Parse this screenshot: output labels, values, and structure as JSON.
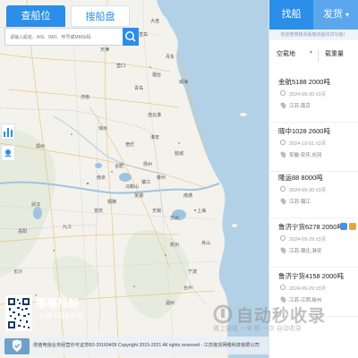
{
  "search": {
    "tabs": [
      {
        "label": "查船位"
      },
      {
        "label": "搜船盘"
      }
    ],
    "placeholder": "请输入船名、AIS、IMO、呼号或MMSI码"
  },
  "map_labels": [
    "南昌",
    "盘锦",
    "大连",
    "北京",
    "天津",
    "秦皇岛",
    "营口",
    "丹东",
    "青岛",
    "烟台",
    "威海",
    "济南",
    "徐州",
    "连云港",
    "南京",
    "上海",
    "合肥",
    "杭州",
    "宁波",
    "武汉",
    "岳阳",
    "长沙",
    "九江",
    "温州",
    "台州",
    "舟山",
    "苏州",
    "无锡",
    "南通",
    "扬州",
    "郑州",
    "芜湖",
    "安庆",
    "铜陵",
    "马鞍山",
    "镇江",
    "泰州",
    "盐城",
    "淮安",
    "宿迁"
  ],
  "promo": {
    "title": "嘟嘟找船",
    "subtitle": "扫描下载手机版"
  },
  "footer": {
    "text": "增值电信业务经营许可证苏B2-20160409    Copyright 2015-2021  All rights reserved  -  江苏拖货网络科技有限公司"
  },
  "panel": {
    "tabs": [
      {
        "label": "找船"
      },
      {
        "label": "发货"
      }
    ],
    "tab_caret": "▾",
    "notice": "欢迎使用拖驳船舶找船找货功能！",
    "filters": [
      {
        "label": "空载地"
      },
      {
        "label": "载重量"
      }
    ],
    "items": [
      {
        "name": "金航5188  2000吨",
        "time": "2024-09-30 ±3天",
        "route": "江苏-南京",
        "badges": []
      },
      {
        "name": "晓中1028  2600吨",
        "time": "2024-10-01 ±3天",
        "route": "安徽-安庆,长冈",
        "badges": []
      },
      {
        "name": "隆运88  8000吨",
        "time": "2024-09-30 ±3天",
        "route": "江苏-镇江",
        "badges": []
      },
      {
        "name": "鲁济宁货6278  2050吨",
        "time": "2024-09-29 ±3天",
        "route": "江苏-宿迁,淮安",
        "badges": [
          "#4a90e2",
          "#e8a33a"
        ]
      },
      {
        "name": "鲁济宁货4158  2000吨",
        "time": "2024-09-29 ±3天",
        "route": "江苏-江阴,徐州",
        "badges": []
      }
    ]
  },
  "watermark": {
    "text": "自动秒收录",
    "sub": "做上链接 一来 即 一次 自动收录"
  }
}
